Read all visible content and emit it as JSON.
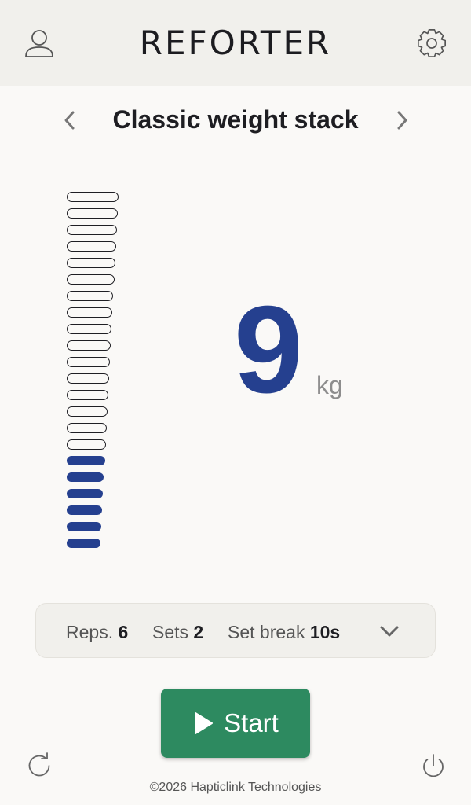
{
  "header": {
    "app_title": "REFORTER",
    "profile_icon": "user-icon",
    "settings_icon": "gear-icon"
  },
  "mode": {
    "title": "Classic weight stack",
    "prev_icon": "chevron-left-icon",
    "next_icon": "chevron-right-icon"
  },
  "weight_stack": {
    "total_plates": 22,
    "active_plates": 6
  },
  "weight": {
    "value": "9",
    "unit": "kg"
  },
  "workout": {
    "reps_label": "Reps.",
    "reps_value": "6",
    "sets_label": "Sets",
    "sets_value": "2",
    "break_label": "Set break",
    "break_value": "10s",
    "expand_icon": "chevron-down-icon"
  },
  "start_button": {
    "label": "Start",
    "icon": "play-icon"
  },
  "bottom": {
    "refresh_icon": "refresh-icon",
    "power_icon": "power-icon"
  },
  "footer": {
    "copyright": "©2026 Hapticlink Technologies"
  },
  "colors": {
    "accent": "#25408f",
    "start": "#2d8a60",
    "header_bg": "#f1f0ec",
    "page_bg": "#faf9f7"
  }
}
